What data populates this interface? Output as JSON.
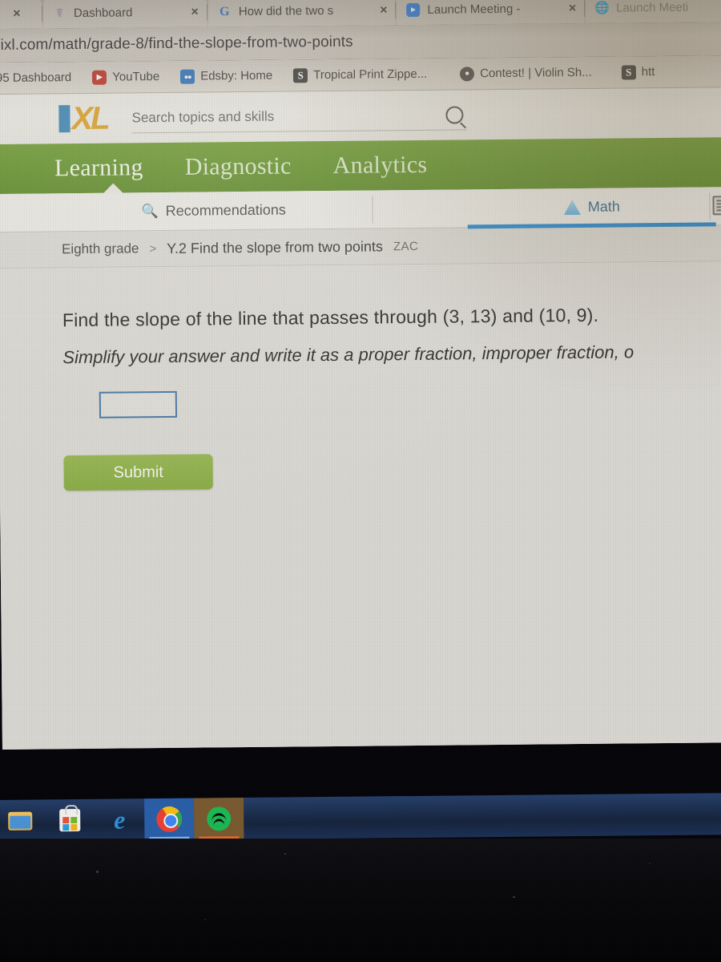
{
  "browser": {
    "tabs": [
      {
        "favicon": "partial-tab-icon",
        "title": "",
        "close_label": "×",
        "active": false
      },
      {
        "favicon": "dashboard-icon",
        "title": "Dashboard",
        "close_label": "×",
        "active": false
      },
      {
        "favicon": "google-icon",
        "title": "How did the two s",
        "close_label": "×",
        "active": false
      },
      {
        "favicon": "zoom-icon",
        "title": "Launch Meeting -",
        "close_label": "×",
        "active": false
      },
      {
        "favicon": "globe-icon",
        "title": "Launch Meeti",
        "close_label": "",
        "active": false
      }
    ],
    "url": "ixl.com/math/grade-8/find-the-slope-from-two-points",
    "bookmarks": [
      {
        "icon": "office365-icon",
        "label": "95 Dashboard"
      },
      {
        "icon": "youtube-icon",
        "label": "YouTube"
      },
      {
        "icon": "edsby-icon",
        "label": "Edsby: Home"
      },
      {
        "icon": "s-icon",
        "label": "Tropical Print Zippe..."
      },
      {
        "icon": "contest-icon",
        "label": "Contest! | Violin Sh..."
      },
      {
        "icon": "s-icon",
        "label": "htt"
      }
    ]
  },
  "ixl": {
    "logo_i": "I",
    "logo_xl": "XL",
    "search": {
      "placeholder": "Search topics and skills",
      "value": "",
      "icon": "search-icon"
    },
    "nav": [
      {
        "label": "Learning",
        "active": true
      },
      {
        "label": "Diagnostic",
        "active": false
      },
      {
        "label": "Analytics",
        "active": false
      }
    ],
    "subnav": {
      "recommendations": {
        "label": "Recommendations",
        "icon": "recommendations-icon"
      },
      "math": {
        "label": "Math",
        "icon": "math-pyramid-icon",
        "active": true
      },
      "clipboard_icon": "clipboard-icon"
    },
    "breadcrumb": {
      "grade": "Eighth grade",
      "separator": ">",
      "skill": "Y.2 Find the slope from two points",
      "user": "ZAC"
    },
    "question": {
      "line1": "Find the slope of the line that passes through (3, 13) and (10, 9).",
      "line2": "Simplify your answer and write it as a proper fraction, improper fraction, o",
      "answer_value": "",
      "submit_label": "Submit"
    },
    "colors": {
      "nav_green": "#649a22",
      "submit_green": "#86b22f",
      "logo_blue": "#3c8dc4",
      "logo_orange": "#e8a317",
      "tab_underline_blue": "#1f8fe0",
      "input_border_blue": "#3f79b0"
    }
  },
  "taskbar": {
    "items": [
      {
        "icon": "file-explorer-icon",
        "label": "File Explorer",
        "active": false
      },
      {
        "icon": "microsoft-store-icon",
        "label": "Microsoft Store",
        "active": false
      },
      {
        "icon": "edge-icon",
        "label": "Microsoft Edge",
        "active": false
      },
      {
        "icon": "chrome-icon",
        "label": "Google Chrome",
        "active": true
      },
      {
        "icon": "spotify-icon",
        "label": "Spotify",
        "active": true
      }
    ]
  }
}
